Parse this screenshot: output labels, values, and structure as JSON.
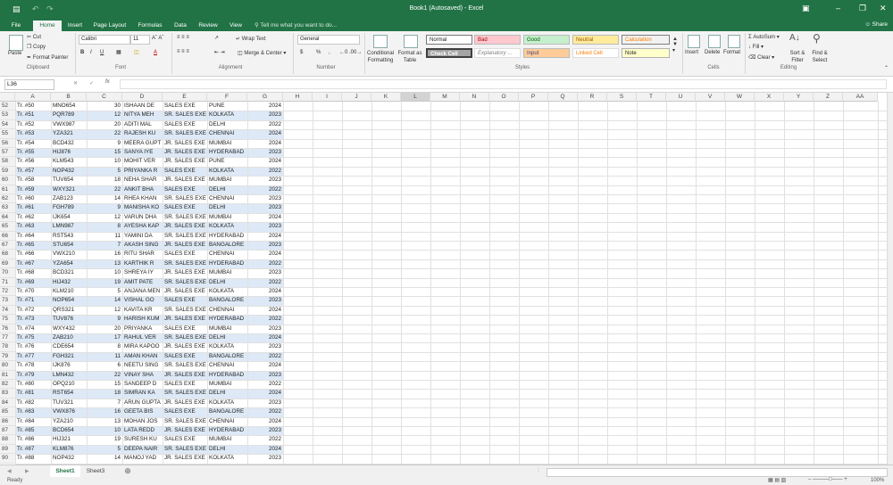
{
  "window": {
    "title": "Book1 (Autosaved) - Excel"
  },
  "tabs": [
    "File",
    "Home",
    "Insert",
    "Page Layout",
    "Formulas",
    "Data",
    "Review",
    "View"
  ],
  "active_tab": "Home",
  "tell_me": "Tell me what you want to do...",
  "share": "Share",
  "ribbon": {
    "clipboard": {
      "paste": "Paste",
      "cut": "Cut",
      "copy": "Copy",
      "painter": "Format Painter",
      "label": "Clipboard"
    },
    "font": {
      "name": "Calibri",
      "size": "11",
      "bold": "B",
      "italic": "I",
      "underline": "U",
      "label": "Font"
    },
    "alignment": {
      "wrap": "Wrap Text",
      "merge": "Merge & Center",
      "label": "Alignment"
    },
    "number": {
      "format": "General",
      "currency": "$",
      "percent": "%",
      "comma": ",",
      "label": "Number"
    },
    "styles": {
      "cond": "Conditional Formatting",
      "table": "Format as Table",
      "normal": "Normal",
      "bad": "Bad",
      "good": "Good",
      "neutral": "Neutral",
      "calculation": "Calculation",
      "check": "Check Cell",
      "explanatory": "Explanatory ...",
      "input": "Input",
      "linked": "Linked Cell",
      "note": "Note",
      "label": "Styles"
    },
    "cells": {
      "insert": "Insert",
      "delete": "Delete",
      "format": "Format",
      "label": "Cells"
    },
    "editing": {
      "autosum": "AutoSum",
      "fill": "Fill",
      "clear": "Clear",
      "sort": "Sort & Filter",
      "find": "Find & Select",
      "label": "Editing"
    }
  },
  "formula_bar": {
    "name_box": "L36",
    "fx": "fx",
    "value": ""
  },
  "columns": [
    "A",
    "B",
    "C",
    "D",
    "E",
    "F",
    "G",
    "H",
    "I",
    "J",
    "K",
    "L",
    "M",
    "N",
    "O",
    "P",
    "Q",
    "R",
    "S",
    "T",
    "U",
    "V",
    "W",
    "X",
    "Y",
    "Z",
    "AA"
  ],
  "rows": [
    {
      "r": "52",
      "a": "Tr. #50",
      "b": "MNO654",
      "c": "30",
      "d": "ISHAAN DE",
      "e": "SALES EXE",
      "f": "PUNE",
      "g": "2024"
    },
    {
      "r": "53",
      "a": "Tr. #51",
      "b": "PQR789",
      "c": "12",
      "d": "NITYA MEH",
      "e": "SR. SALES EXE",
      "f": "KOLKATA",
      "g": "2023"
    },
    {
      "r": "54",
      "a": "Tr. #52",
      "b": "VWX987",
      "c": "20",
      "d": "ADITI MAL",
      "e": "SALES EXE",
      "f": "DELHI",
      "g": "2022"
    },
    {
      "r": "55",
      "a": "Tr. #53",
      "b": "YZA321",
      "c": "22",
      "d": "RAJESH KU",
      "e": "SR. SALES EXE",
      "f": "CHENNAI",
      "g": "2024"
    },
    {
      "r": "56",
      "a": "Tr. #54",
      "b": "BCD432",
      "c": "9",
      "d": "MEERA GUPT",
      "e": "JR. SALES EXE",
      "f": "MUMBAI",
      "g": "2024"
    },
    {
      "r": "57",
      "a": "Tr. #55",
      "b": "HIJ876",
      "c": "15",
      "d": "SANYA IYE",
      "e": "JR. SALES EXE",
      "f": "HYDERABAD",
      "g": "2023"
    },
    {
      "r": "58",
      "a": "Tr. #56",
      "b": "KLM543",
      "c": "10",
      "d": "MOHIT VER",
      "e": "JR. SALES EXE",
      "f": "PUNE",
      "g": "2024"
    },
    {
      "r": "59",
      "a": "Tr. #57",
      "b": "NOP432",
      "c": "5",
      "d": "PRIYANKA R",
      "e": "SALES EXE",
      "f": "KOLKATA",
      "g": "2022"
    },
    {
      "r": "60",
      "a": "Tr. #58",
      "b": "TUV654",
      "c": "18",
      "d": "NEHA SHAR",
      "e": "JR. SALES EXE",
      "f": "MUMBAI",
      "g": "2023"
    },
    {
      "r": "61",
      "a": "Tr. #59",
      "b": "WXY321",
      "c": "22",
      "d": "ANKIT BHA",
      "e": "SALES EXE",
      "f": "DELHI",
      "g": "2022"
    },
    {
      "r": "62",
      "a": "Tr. #60",
      "b": "ZAB123",
      "c": "14",
      "d": "RHEA KHAN",
      "e": "SR. SALES EXE",
      "f": "CHENNAI",
      "g": "2023"
    },
    {
      "r": "63",
      "a": "Tr. #61",
      "b": "FGH789",
      "c": "9",
      "d": "MANISHA KO",
      "e": "SALES EXE",
      "f": "DELHI",
      "g": "2023"
    },
    {
      "r": "64",
      "a": "Tr. #62",
      "b": "IJK654",
      "c": "12",
      "d": "VARUN DHA",
      "e": "SR. SALES EXE",
      "f": "MUMBAI",
      "g": "2024"
    },
    {
      "r": "65",
      "a": "Tr. #63",
      "b": "LMN987",
      "c": "8",
      "d": "AYESHA KAP",
      "e": "JR. SALES EXE",
      "f": "KOLKATA",
      "g": "2023"
    },
    {
      "r": "66",
      "a": "Tr. #64",
      "b": "RST543",
      "c": "11",
      "d": "YAMINI DA",
      "e": "SR. SALES EXE",
      "f": "HYDERABAD",
      "g": "2024"
    },
    {
      "r": "67",
      "a": "Tr. #65",
      "b": "STU654",
      "c": "7",
      "d": "AKASH SING",
      "e": "JR. SALES EXE",
      "f": "BANGALORE",
      "g": "2023"
    },
    {
      "r": "68",
      "a": "Tr. #66",
      "b": "VWX210",
      "c": "16",
      "d": "RITU SHAR",
      "e": "SALES EXE",
      "f": "CHENNAI",
      "g": "2024"
    },
    {
      "r": "69",
      "a": "Tr. #67",
      "b": "YZA654",
      "c": "13",
      "d": "KARTHIK R",
      "e": "SR. SALES EXE",
      "f": "HYDERABAD",
      "g": "2022"
    },
    {
      "r": "70",
      "a": "Tr. #68",
      "b": "BCD321",
      "c": "10",
      "d": "SHREYA IY",
      "e": "JR. SALES EXE",
      "f": "MUMBAI",
      "g": "2023"
    },
    {
      "r": "71",
      "a": "Tr. #69",
      "b": "HIJ432",
      "c": "19",
      "d": "AMIT PATE",
      "e": "SR. SALES EXE",
      "f": "DELHI",
      "g": "2022"
    },
    {
      "r": "72",
      "a": "Tr. #70",
      "b": "KLM210",
      "c": "5",
      "d": "ANJANA MEN",
      "e": "JR. SALES EXE",
      "f": "KOLKATA",
      "g": "2024"
    },
    {
      "r": "73",
      "a": "Tr. #71",
      "b": "NOP654",
      "c": "14",
      "d": "VISHAL GO",
      "e": "SALES EXE",
      "f": "BANGALORE",
      "g": "2023"
    },
    {
      "r": "74",
      "a": "Tr. #72",
      "b": "QRS321",
      "c": "12",
      "d": "KAVITA KR",
      "e": "SR. SALES EXE",
      "f": "CHENNAI",
      "g": "2024"
    },
    {
      "r": "75",
      "a": "Tr. #73",
      "b": "TUV876",
      "c": "9",
      "d": "HARISH KUM",
      "e": "JR. SALES EXE",
      "f": "HYDERABAD",
      "g": "2022"
    },
    {
      "r": "76",
      "a": "Tr. #74",
      "b": "WXY432",
      "c": "20",
      "d": "PRIYANKA",
      "e": "SALES EXE",
      "f": "MUMBAI",
      "g": "2023"
    },
    {
      "r": "77",
      "a": "Tr. #75",
      "b": "ZAB210",
      "c": "17",
      "d": "RAHUL VER",
      "e": "SR. SALES EXE",
      "f": "DELHI",
      "g": "2024"
    },
    {
      "r": "78",
      "a": "Tr. #76",
      "b": "CDE654",
      "c": "8",
      "d": "MIRA KAPOO",
      "e": "JR. SALES EXE",
      "f": "KOLKATA",
      "g": "2023"
    },
    {
      "r": "79",
      "a": "Tr. #77",
      "b": "FGH321",
      "c": "11",
      "d": "AMAN KHAN",
      "e": "SALES EXE",
      "f": "BANGALORE",
      "g": "2022"
    },
    {
      "r": "80",
      "a": "Tr. #78",
      "b": "IJK876",
      "c": "6",
      "d": "NEETU SING",
      "e": "SR. SALES EXE",
      "f": "CHENNAI",
      "g": "2024"
    },
    {
      "r": "81",
      "a": "Tr. #79",
      "b": "LMN432",
      "c": "22",
      "d": "VINAY SHA",
      "e": "JR. SALES EXE",
      "f": "HYDERABAD",
      "g": "2023"
    },
    {
      "r": "82",
      "a": "Tr. #80",
      "b": "OPQ210",
      "c": "15",
      "d": "SANDEEP D",
      "e": "SALES EXE",
      "f": "MUMBAI",
      "g": "2022"
    },
    {
      "r": "83",
      "a": "Tr. #81",
      "b": "RST654",
      "c": "18",
      "d": "SIMRAN KA",
      "e": "SR. SALES EXE",
      "f": "DELHI",
      "g": "2024"
    },
    {
      "r": "84",
      "a": "Tr. #82",
      "b": "TUV321",
      "c": "7",
      "d": "ARUN GUPTA",
      "e": "JR. SALES EXE",
      "f": "KOLKATA",
      "g": "2023"
    },
    {
      "r": "85",
      "a": "Tr. #83",
      "b": "VWX876",
      "c": "16",
      "d": "GEETA BIS",
      "e": "SALES EXE",
      "f": "BANGALORE",
      "g": "2022"
    },
    {
      "r": "86",
      "a": "Tr. #84",
      "b": "YZA210",
      "c": "13",
      "d": "MOHAN JOS",
      "e": "SR. SALES EXE",
      "f": "CHENNAI",
      "g": "2024"
    },
    {
      "r": "87",
      "a": "Tr. #85",
      "b": "BCD654",
      "c": "10",
      "d": "LATA REDD",
      "e": "JR. SALES EXE",
      "f": "HYDERABAD",
      "g": "2023"
    },
    {
      "r": "88",
      "a": "Tr. #86",
      "b": "HIJ321",
      "c": "19",
      "d": "SURESH KU",
      "e": "SALES EXE",
      "f": "MUMBAI",
      "g": "2022"
    },
    {
      "r": "89",
      "a": "Tr. #87",
      "b": "KLM876",
      "c": "5",
      "d": "DEEPA NAIR",
      "e": "SR. SALES EXE",
      "f": "DELHI",
      "g": "2024"
    },
    {
      "r": "90",
      "a": "Tr. #88",
      "b": "NOP432",
      "c": "14",
      "d": "MANOJ YAD",
      "e": "JR. SALES EXE",
      "f": "KOLKATA",
      "g": "2023"
    }
  ],
  "sheets": [
    "Sheet1",
    "Sheet3"
  ],
  "active_sheet": "Sheet1",
  "status": {
    "ready": "Ready",
    "zoom": "100%"
  },
  "colors": {
    "accent": "#217346",
    "band": "#dde9f6"
  }
}
